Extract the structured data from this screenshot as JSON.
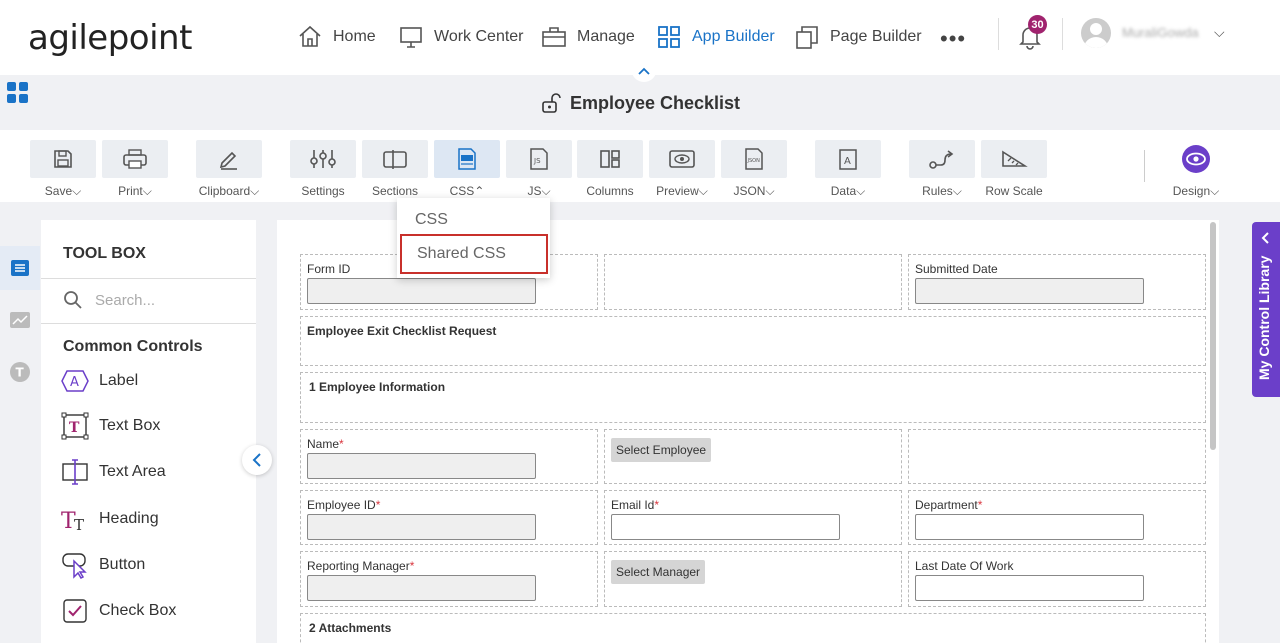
{
  "brand": {
    "logo_text": "agilepoint"
  },
  "nav": {
    "items": [
      {
        "label": "Home",
        "icon": "home-icon"
      },
      {
        "label": "Work Center",
        "icon": "monitor-icon"
      },
      {
        "label": "Manage",
        "icon": "briefcase-icon"
      },
      {
        "label": "App Builder",
        "icon": "grid-icon",
        "active": true
      },
      {
        "label": "Page Builder",
        "icon": "pages-icon"
      }
    ],
    "more": "•••",
    "notification_count": "30",
    "username": "MuraliGowda"
  },
  "page": {
    "title": "Employee Checklist"
  },
  "toolbar": {
    "items": [
      {
        "label": "Save",
        "dropdown": true
      },
      {
        "label": "Print",
        "dropdown": true
      },
      {
        "label": "Clipboard",
        "dropdown": true
      },
      {
        "label": "Settings"
      },
      {
        "label": "Sections"
      },
      {
        "label": "CSS",
        "dropdown": true,
        "open": true
      },
      {
        "label": "JS",
        "dropdown": true
      },
      {
        "label": "Columns"
      },
      {
        "label": "Preview",
        "dropdown": true
      },
      {
        "label": "JSON",
        "dropdown": true
      },
      {
        "label": "Data",
        "dropdown": true
      },
      {
        "label": "Rules",
        "dropdown": true
      },
      {
        "label": "Row Scale"
      },
      {
        "label": "Design",
        "dropdown": true
      }
    ]
  },
  "css_menu": {
    "items": [
      "CSS",
      "Shared CSS"
    ],
    "highlighted": "Shared CSS"
  },
  "toolbox": {
    "title": "TOOL BOX",
    "search_placeholder": "Search...",
    "section": "Common Controls",
    "controls": [
      "Label",
      "Text Box",
      "Text Area",
      "Heading",
      "Button",
      "Check Box"
    ]
  },
  "form": {
    "form_id_label": "Form ID",
    "submitted_date_label": "Submitted Date",
    "section_request": "Employee Exit Checklist Request",
    "section_employee_info": "1 Employee Information",
    "name_label": "Name",
    "select_employee": "Select Employee",
    "employee_id_label": "Employee ID",
    "email_label": "Email Id",
    "department_label": "Department",
    "reporting_manager_label": "Reporting Manager",
    "select_manager": "Select Manager",
    "last_date_label": "Last Date Of Work",
    "section_attachments": "2 Attachments",
    "required_mark": "*"
  },
  "control_library": {
    "label": "My Control Library"
  },
  "colors": {
    "accent": "#1a73c7",
    "badge": "#a0236e",
    "library_tab": "#6b3fc9",
    "highlight_border": "#c8302b"
  }
}
